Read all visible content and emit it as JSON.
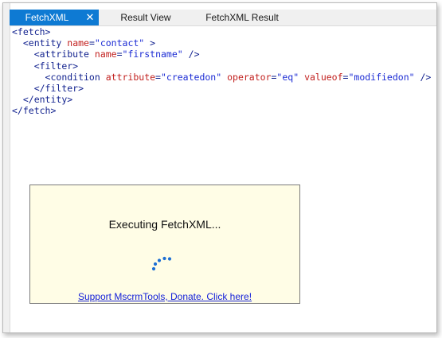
{
  "colors": {
    "accent": "#0e7ad3",
    "popup_bg": "#fffde6",
    "link": "#1521d9",
    "spinner": "#1d6fd4"
  },
  "tabs": [
    {
      "label": "FetchXML",
      "active": true,
      "close_icon": "close-icon",
      "close_glyph": "✕"
    },
    {
      "label": "Result View",
      "active": false
    },
    {
      "label": "FetchXML Result",
      "active": false
    }
  ],
  "editor": {
    "lines": [
      {
        "text": "<fetch>"
      },
      {
        "text": "  <entity name=\"contact\" >"
      },
      {
        "text": "    <attribute name=\"firstname\" />"
      },
      {
        "text": "    <filter>"
      },
      {
        "text": "      <condition attribute=\"createdon\" operator=\"eq\" valueof=\"modifiedon\" />"
      },
      {
        "text": "    </filter>"
      },
      {
        "text": "  </entity>"
      },
      {
        "text": "</fetch>"
      }
    ]
  },
  "loading": {
    "message": "Executing FetchXML...",
    "spinner_icon": "loading-spinner-icon",
    "link_text": "Support MscrmTools, Donate. Click here!"
  }
}
